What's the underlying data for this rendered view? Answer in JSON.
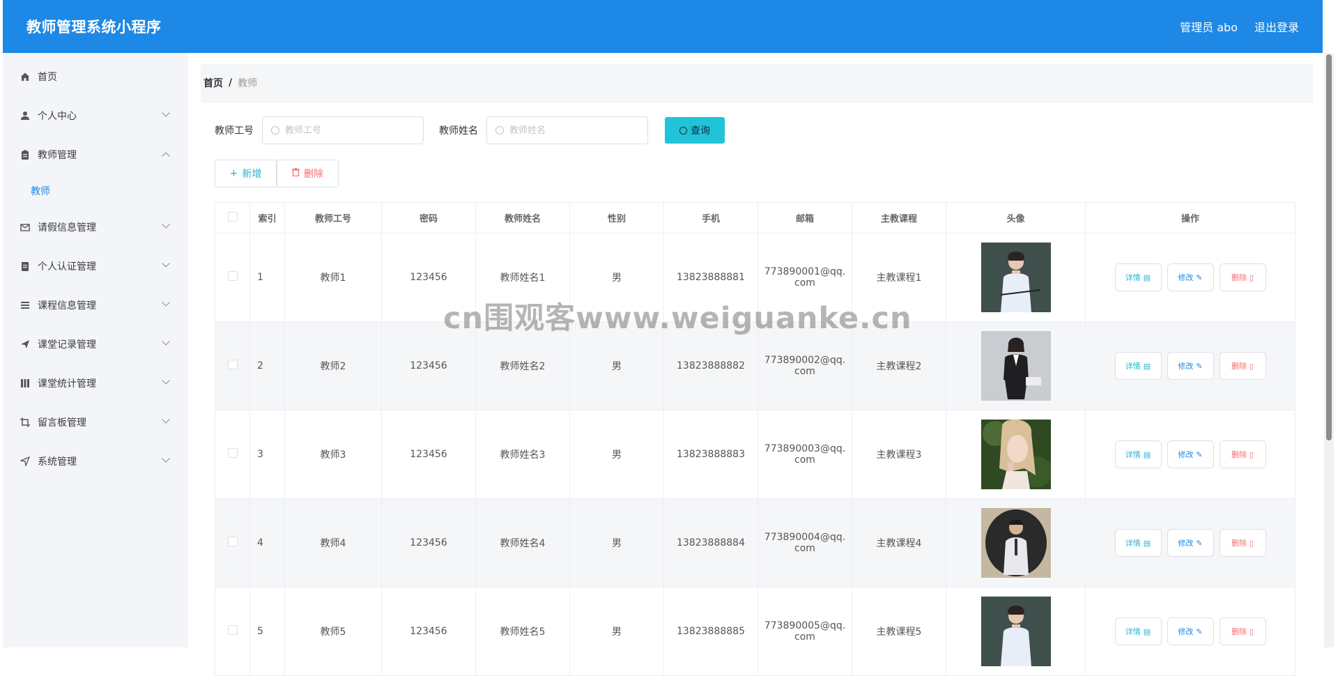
{
  "header": {
    "app_title": "教师管理系统小程序",
    "user_label": "管理员 abo",
    "logout_label": "退出登录"
  },
  "sidebar": {
    "items": [
      {
        "label": "首页",
        "icon": "home-icon"
      },
      {
        "label": "个人中心",
        "icon": "user-icon"
      },
      {
        "label": "教师管理",
        "icon": "clipboard-icon",
        "expanded": true
      },
      {
        "label": "请假信息管理",
        "icon": "mail-icon"
      },
      {
        "label": "个人认证管理",
        "icon": "document-icon"
      },
      {
        "label": "课程信息管理",
        "icon": "list-icon"
      },
      {
        "label": "课堂记录管理",
        "icon": "send-icon"
      },
      {
        "label": "课堂统计管理",
        "icon": "chart-icon"
      },
      {
        "label": "留言板管理",
        "icon": "crop-icon"
      },
      {
        "label": "系统管理",
        "icon": "navigation-icon"
      }
    ],
    "sub_item": "教师"
  },
  "breadcrumb": {
    "home": "首页",
    "separator": "/",
    "current": "教师"
  },
  "search": {
    "id_label": "教师工号",
    "id_placeholder": "教师工号",
    "name_label": "教师姓名",
    "name_placeholder": "教师姓名",
    "query_button": "查询"
  },
  "actions": {
    "add_label": "新增",
    "delete_label": "删除"
  },
  "table": {
    "headers": [
      "索引",
      "教师工号",
      "密码",
      "教师姓名",
      "性别",
      "手机",
      "邮箱",
      "主教课程",
      "头像",
      "操作"
    ],
    "rows": [
      {
        "index": "1",
        "id": "教师1",
        "password": "123456",
        "name": "教师姓名1",
        "gender": "男",
        "phone": "13823888881",
        "email_line1": "773890001@qq.",
        "email_line2": "com",
        "course": "主教课程1"
      },
      {
        "index": "2",
        "id": "教师2",
        "password": "123456",
        "name": "教师姓名2",
        "gender": "男",
        "phone": "13823888882",
        "email_line1": "773890002@qq.",
        "email_line2": "com",
        "course": "主教课程2"
      },
      {
        "index": "3",
        "id": "教师3",
        "password": "123456",
        "name": "教师姓名3",
        "gender": "男",
        "phone": "13823888883",
        "email_line1": "773890003@qq.",
        "email_line2": "com",
        "course": "主教课程3"
      },
      {
        "index": "4",
        "id": "教师4",
        "password": "123456",
        "name": "教师姓名4",
        "gender": "男",
        "phone": "13823888884",
        "email_line1": "773890004@qq.",
        "email_line2": "com",
        "course": "主教课程4"
      },
      {
        "index": "5",
        "id": "教师5",
        "password": "123456",
        "name": "教师姓名5",
        "gender": "男",
        "phone": "13823888885",
        "email_line1": "773890005@qq.",
        "email_line2": "com",
        "course": "主教课程5"
      }
    ],
    "op_detail": "详情",
    "op_edit": "修改",
    "op_delete": "删除"
  },
  "watermark": "cn围观客www.weiguanke.cn",
  "colors": {
    "header_bg": "#1d88e5",
    "accent": "#21c3d8",
    "danger": "#f56c6c",
    "sidebar_bg": "#f3f5f8"
  }
}
